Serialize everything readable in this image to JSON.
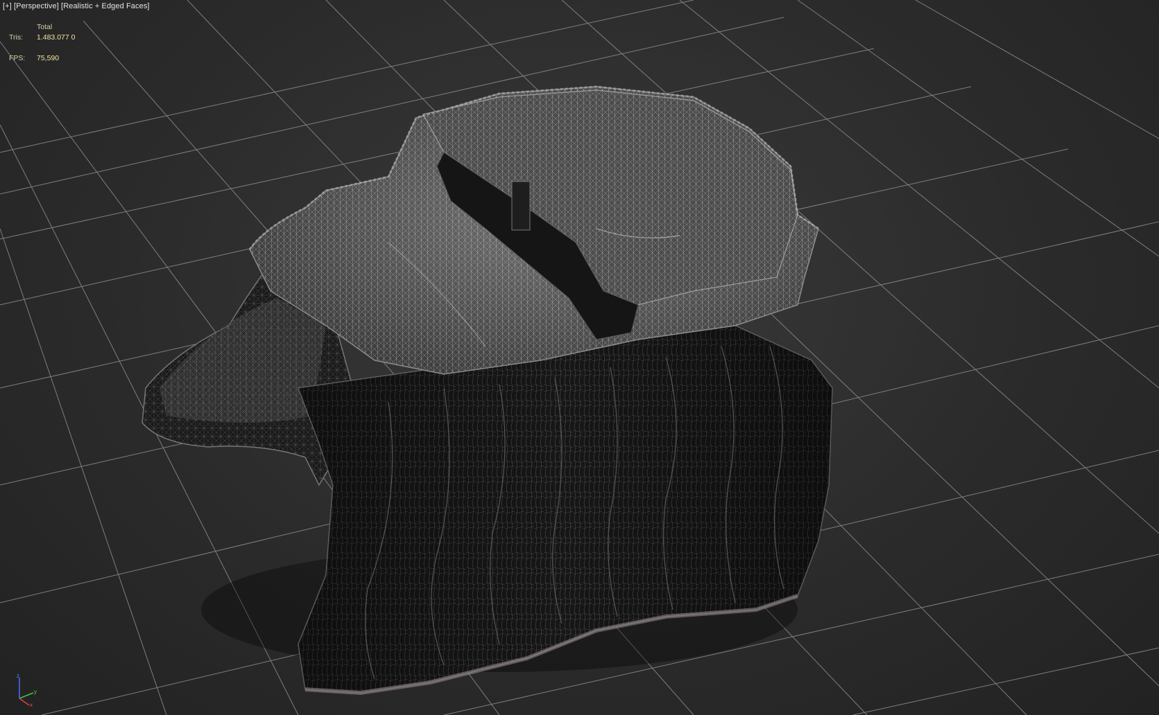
{
  "viewport": {
    "label_plus": "[+]",
    "label_view": "[Perspective]",
    "label_shading": "[Realistic + Edged Faces]"
  },
  "stats": {
    "header_total": "Total",
    "tris_label": "Tris:",
    "tris_value": "1.483.077 0",
    "fps_label": "FPS:",
    "fps_value": "75,590"
  },
  "gizmo": {
    "axis_x": "x",
    "axis_y": "y",
    "axis_z": "z"
  },
  "colors": {
    "background": "#2f2f2f",
    "grid_line": "#9a9a9a",
    "stats_text": "#f2e2a0",
    "mesh_dark": "#161616",
    "mesh_light": "#bdbdbd"
  }
}
